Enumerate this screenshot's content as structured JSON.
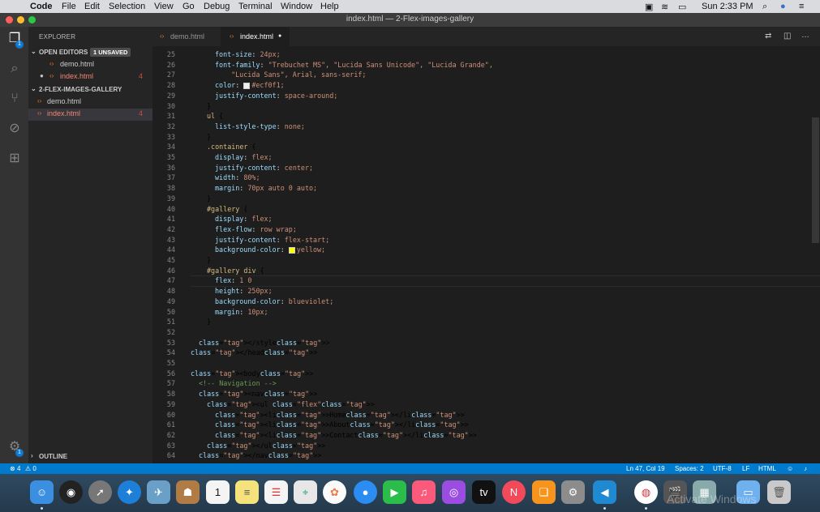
{
  "menubar": {
    "app": "Code",
    "items": [
      "File",
      "Edit",
      "Selection",
      "View",
      "Go",
      "Debug",
      "Terminal",
      "Window",
      "Help"
    ],
    "clock": "Sun 2:33 PM"
  },
  "window": {
    "title": "index.html — 2-Flex-images-gallery"
  },
  "sidebar": {
    "header": "EXPLORER",
    "open_editors": {
      "label": "OPEN EDITORS",
      "badge": "1 UNSAVED",
      "files": [
        {
          "name": "demo.html",
          "count": ""
        },
        {
          "name": "index.html",
          "count": "4"
        }
      ]
    },
    "project": {
      "label": "2-FLEX-IMAGES-GALLERY",
      "files": [
        {
          "name": "demo.html",
          "count": ""
        },
        {
          "name": "index.html",
          "count": "4"
        }
      ]
    },
    "outline": "OUTLINE"
  },
  "tabs": [
    {
      "name": "demo.html"
    },
    {
      "name": "index.html"
    }
  ],
  "editor": {
    "line_numbers": [
      "25",
      "26",
      "27",
      "28",
      "29",
      "30",
      "31",
      "32",
      "33",
      "34",
      "35",
      "36",
      "37",
      "38",
      "39",
      "40",
      "41",
      "42",
      "43",
      "44",
      "45",
      "46",
      "47",
      "48",
      "49",
      "50",
      "51",
      "52",
      "53",
      "54",
      "55",
      "56",
      "57",
      "58",
      "59",
      "60",
      "61",
      "62",
      "63",
      "64"
    ],
    "code": [
      [
        "",
        "font-size: 24px;"
      ],
      [
        "",
        "font-family: \"Trebuchet MS\", \"Lucida Sans Unicode\", \"Lucida Grande\","
      ],
      [
        "",
        "  \"Lucida Sans\", Arial, sans-serif;"
      ],
      [
        "",
        "color: #ecf0f1;"
      ],
      [
        "",
        "justify-content: space-around;"
      ],
      [
        "",
        "}"
      ],
      [
        "",
        "ul {"
      ],
      [
        "",
        "list-style-type: none;"
      ],
      [
        "",
        "}"
      ],
      [
        "",
        ".container {"
      ],
      [
        "",
        "display: flex;"
      ],
      [
        "",
        "justify-content: center;"
      ],
      [
        "",
        "width: 80%;"
      ],
      [
        "",
        "margin: 70px auto 0 auto;"
      ],
      [
        "",
        "}"
      ],
      [
        "",
        "#gallery {"
      ],
      [
        "",
        "display: flex;"
      ],
      [
        "",
        "flex-flow: row wrap;"
      ],
      [
        "",
        "justify-content: flex-start;"
      ],
      [
        "",
        "background-color: yellow;"
      ],
      [
        "",
        "}"
      ],
      [
        "",
        "#gallery div {"
      ],
      [
        "",
        "flex: 1 0"
      ],
      [
        "",
        "height: 250px;"
      ],
      [
        "",
        "background-color: blueviolet;"
      ],
      [
        "",
        "margin: 10px;"
      ],
      [
        "",
        "}"
      ],
      [
        "",
        ""
      ],
      [
        "",
        "</style>"
      ],
      [
        "",
        "</head>"
      ],
      [
        "",
        ""
      ],
      [
        "",
        "<body>"
      ],
      [
        "",
        "<!-- Navigation -->"
      ],
      [
        "",
        "<nav>"
      ],
      [
        "",
        "<ul class=\"flex\">"
      ],
      [
        "",
        "<li>Home</li>"
      ],
      [
        "",
        "<li>About</li>"
      ],
      [
        "",
        "<li>Contact</li>"
      ],
      [
        "",
        "</ul>"
      ],
      [
        "",
        "</nav>"
      ]
    ]
  },
  "status": {
    "errors": "4",
    "warnings": "0",
    "position": "Ln 47, Col 19",
    "spaces": "Spaces: 2",
    "encoding": "UTF-8",
    "eol": "LF",
    "language": "HTML"
  },
  "watermark": "Activate Windows",
  "colors": {
    "accent": "#007acc",
    "swatch_ecf0f1": "#ecf0f1",
    "swatch_yellow": "#ffff00"
  }
}
